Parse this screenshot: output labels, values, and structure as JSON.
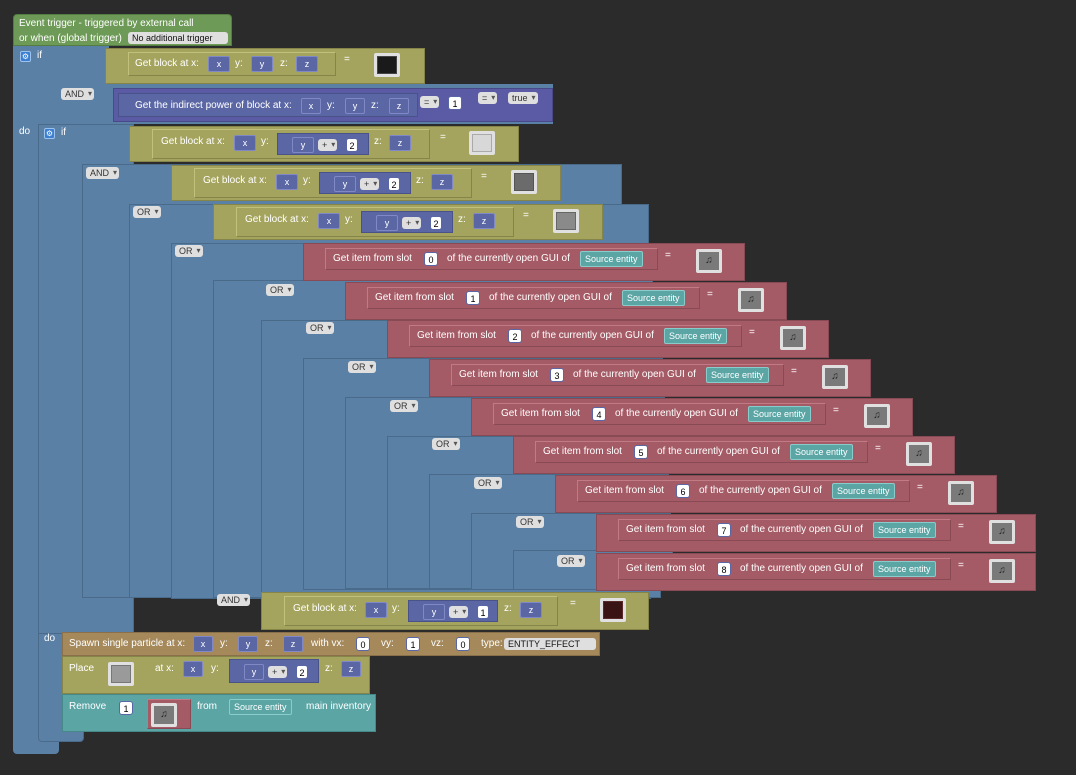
{
  "event": {
    "header_label": "Event trigger - triggered by external call",
    "global_label": "or when (global trigger)",
    "global_trigger_value": "No additional trigger"
  },
  "labels": {
    "if": "if",
    "do": "do",
    "and": "AND",
    "or": "OR",
    "get_block_at_x": "Get block at x:",
    "y": "y:",
    "z": "z:",
    "indirect_power": "Get the indirect power of block at x:",
    "get_item_from_slot": "Get item from slot",
    "of_gui": "of the currently open GUI of",
    "spawn_particle": "Spawn single particle at x:",
    "with_vx": "with vx:",
    "vy": "vy:",
    "vz": "vz:",
    "type": "type:",
    "place": "Place",
    "at_x": "at x:",
    "remove": "Remove",
    "from": "from",
    "main_inventory": "main inventory",
    "equals": "=",
    "plus": "+"
  },
  "vars": {
    "x": "x",
    "y": "y",
    "z": "z"
  },
  "entity": "Source entity",
  "values": {
    "indirect_power_value": "1",
    "offset_two": "2",
    "offset_one": "1",
    "true_value": "true",
    "vx": "0",
    "vy": "1",
    "vz": "0",
    "particle_type": "ENTITY_EFFECT",
    "remove_count": "1"
  },
  "slots": [
    {
      "slot": "0",
      "logic": ""
    },
    {
      "slot": "1",
      "logic": "OR"
    },
    {
      "slot": "2",
      "logic": "OR"
    },
    {
      "slot": "3",
      "logic": "OR"
    },
    {
      "slot": "4",
      "logic": "OR"
    },
    {
      "slot": "5",
      "logic": "OR"
    },
    {
      "slot": "6",
      "logic": "OR"
    },
    {
      "slot": "7",
      "logic": "OR"
    },
    {
      "slot": "8",
      "logic": "OR"
    }
  ],
  "colors": {
    "event_block": "#6d9a56",
    "control_block": "#5b80a5",
    "world_block": "#a4a45e",
    "item_block": "#a55b66",
    "action_block": "#a5895b",
    "entity_block": "#5ba5a5",
    "math_block": "#5b67a5",
    "background": "#2b2b2b"
  },
  "icons": {
    "gear": "gear-icon",
    "obsidian": "obsidian-block-icon",
    "iron": "iron-block-icon",
    "stone": "stone-block-icon",
    "smooth_stone": "smooth-stone-icon",
    "music_disc": "music-disc-icon",
    "netherrack": "block-icon-dark-red",
    "air": "air-block-icon"
  }
}
